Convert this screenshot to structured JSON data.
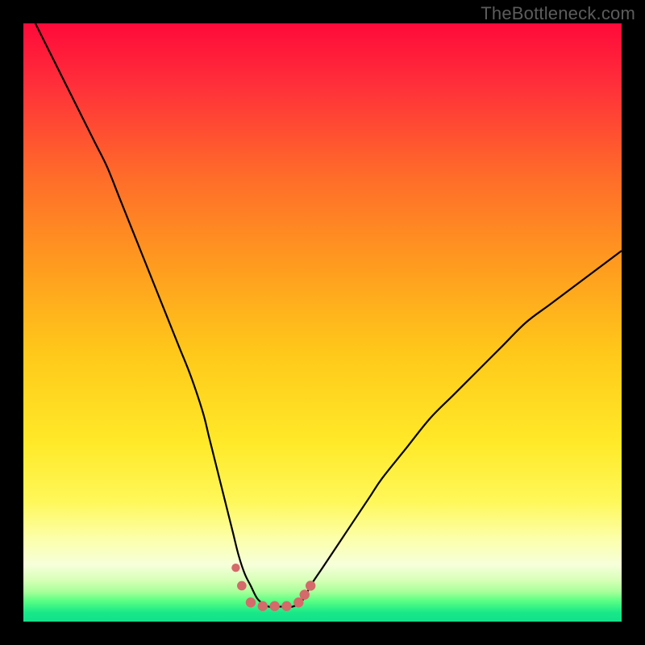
{
  "watermark": "TheBottleneck.com",
  "colors": {
    "frame_bg": "#000000",
    "curve": "#000000",
    "marker_fill": "#d46a6a",
    "marker_stroke": "#d46a6a",
    "gradient_stops": [
      {
        "offset": 0.0,
        "color": "#ff0a3a"
      },
      {
        "offset": 0.1,
        "color": "#ff2e3a"
      },
      {
        "offset": 0.25,
        "color": "#ff6a2a"
      },
      {
        "offset": 0.4,
        "color": "#ff9a1f"
      },
      {
        "offset": 0.55,
        "color": "#ffc81a"
      },
      {
        "offset": 0.7,
        "color": "#ffe928"
      },
      {
        "offset": 0.8,
        "color": "#fff85a"
      },
      {
        "offset": 0.86,
        "color": "#fcffa8"
      },
      {
        "offset": 0.905,
        "color": "#f6ffda"
      },
      {
        "offset": 0.93,
        "color": "#d8ffb8"
      },
      {
        "offset": 0.95,
        "color": "#a8ff9a"
      },
      {
        "offset": 0.965,
        "color": "#5cff84"
      },
      {
        "offset": 0.985,
        "color": "#18e888"
      },
      {
        "offset": 1.0,
        "color": "#12e08a"
      }
    ]
  },
  "chart_data": {
    "type": "line",
    "title": "",
    "xlabel": "",
    "ylabel": "",
    "xlim": [
      0,
      100
    ],
    "ylim": [
      0,
      100
    ],
    "grid": false,
    "series": [
      {
        "name": "bottleneck-curve",
        "x": [
          2,
          4,
          6,
          8,
          10,
          12,
          14,
          16,
          18,
          20,
          22,
          24,
          26,
          28,
          30,
          31,
          32,
          33,
          34,
          35,
          36,
          37,
          38,
          39,
          40,
          41,
          42,
          43,
          44,
          45,
          46,
          47,
          48,
          50,
          52,
          54,
          56,
          58,
          60,
          64,
          68,
          72,
          76,
          80,
          84,
          88,
          92,
          96,
          100
        ],
        "y": [
          100,
          96,
          92,
          88,
          84,
          80,
          76,
          71,
          66,
          61,
          56,
          51,
          46,
          41,
          35,
          31,
          27,
          23,
          19,
          15,
          11,
          8,
          6,
          4,
          3,
          2.5,
          2.5,
          2.5,
          2.5,
          2.5,
          3,
          4,
          6,
          9,
          12,
          15,
          18,
          21,
          24,
          29,
          34,
          38,
          42,
          46,
          50,
          53,
          56,
          59,
          62
        ]
      }
    ],
    "markers": {
      "name": "bottleneck-floor-markers",
      "x": [
        35.5,
        36.5,
        38,
        40,
        42,
        44,
        46,
        47,
        48
      ],
      "y": [
        9,
        6,
        3.2,
        2.6,
        2.6,
        2.6,
        3.2,
        4.5,
        6
      ],
      "r": [
        5.2,
        5.8,
        6.2,
        6.2,
        6.2,
        6.2,
        6.2,
        6.2,
        6.2
      ]
    }
  }
}
